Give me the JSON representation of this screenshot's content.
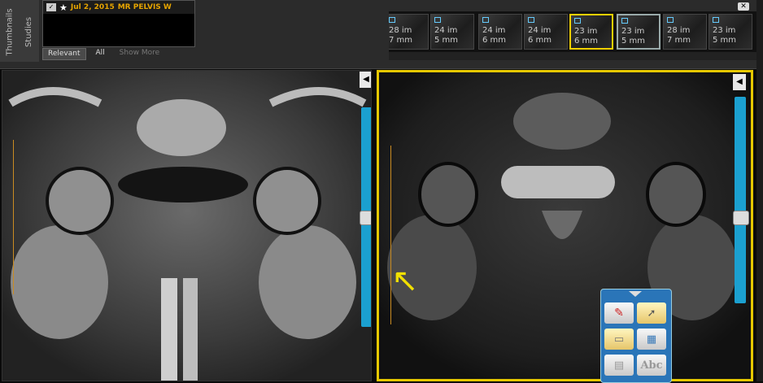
{
  "sidebar": {
    "thumbnails_tab": "Thumbnails",
    "studies_tab": "Studies"
  },
  "study": {
    "date": "Jul 2, 2015",
    "name": "MR  PELVIS W"
  },
  "filters": {
    "relevant": "Relevant",
    "all": "All",
    "show_more": "Show More"
  },
  "thumbnails": [
    {
      "count": "28 im",
      "thickness": "7 mm"
    },
    {
      "count": "24 im",
      "thickness": "5 mm"
    },
    {
      "count": "24 im",
      "thickness": "6 mm"
    },
    {
      "count": "24 im",
      "thickness": "6 mm"
    },
    {
      "count": "23 im",
      "thickness": "6 mm"
    },
    {
      "count": "23 im",
      "thickness": "5 mm"
    },
    {
      "count": "28 im",
      "thickness": "7 mm"
    },
    {
      "count": "23 im",
      "thickness": "5 mm"
    }
  ],
  "icons": [
    "star-icon",
    "check-icon",
    "close-icon",
    "collapse-arrow-icon",
    "pencil-icon",
    "pointer-icon",
    "eraser-icon",
    "layout-icon",
    "text-abc-icon"
  ],
  "tools": {
    "text_tool": "Abc"
  },
  "colors": {
    "accent_yellow": "#e6c800",
    "scroll_blue": "#1ba0d0",
    "study_orange": "#e6a400"
  }
}
